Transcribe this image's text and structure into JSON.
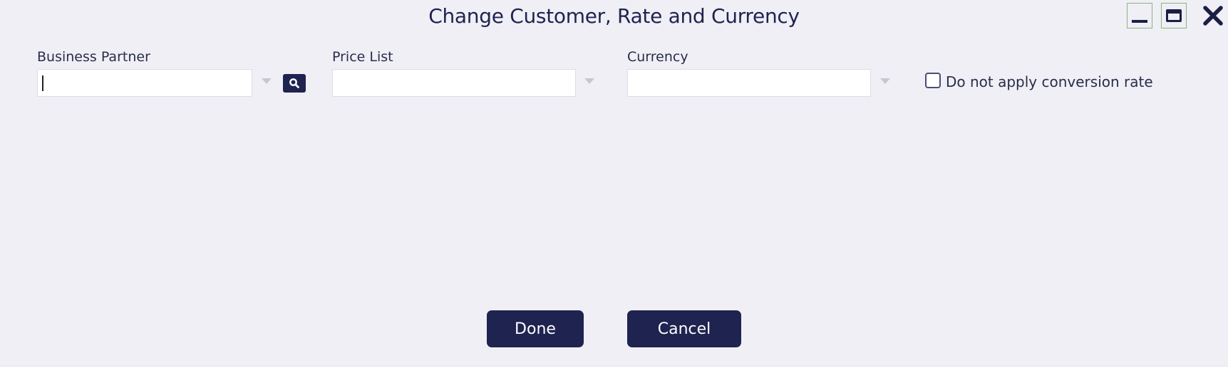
{
  "dialog": {
    "title": "Change Customer, Rate and Currency"
  },
  "window_controls": {
    "minimize_icon": "minimize-icon",
    "maximize_icon": "maximize-icon",
    "close_icon": "close-icon"
  },
  "fields": {
    "business_partner": {
      "label": "Business Partner",
      "value": ""
    },
    "price_list": {
      "label": "Price List",
      "value": ""
    },
    "currency": {
      "label": "Currency",
      "value": ""
    }
  },
  "conversion": {
    "label": "Do not apply conversion rate",
    "checked": false
  },
  "buttons": {
    "done": "Done",
    "cancel": "Cancel"
  },
  "colors": {
    "background": "#efeff5",
    "primary": "#1f2350",
    "window_btn_border": "#8fb37c"
  }
}
